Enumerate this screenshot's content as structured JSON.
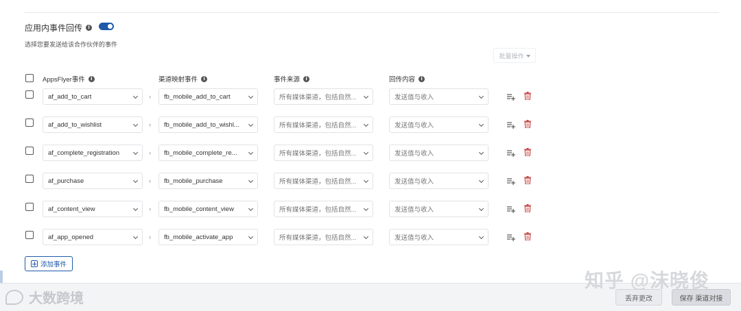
{
  "section": {
    "title": "应用内事件回传",
    "subtitle": "选择您要发送给该合作伙伴的事件",
    "toggle_on": true,
    "accent": "#1d59a8"
  },
  "bulk_action": {
    "label": "批量操作"
  },
  "columns": {
    "appsflyer": "AppsFlyer事件",
    "mapped": "渠道映射事件",
    "source": "事件来源",
    "content": "回传内容"
  },
  "rows": [
    {
      "af": "af_add_to_cart",
      "fb": "fb_mobile_add_to_cart",
      "source": "所有媒体渠道，包括自然...",
      "content": "发送值与收入"
    },
    {
      "af": "af_add_to_wishlist",
      "fb": "fb_mobile_add_to_wishl...",
      "source": "所有媒体渠道，包括自然...",
      "content": "发送值与收入"
    },
    {
      "af": "af_complete_registration",
      "fb": "fb_mobile_complete_re...",
      "source": "所有媒体渠道，包括自然...",
      "content": "发送值与收入"
    },
    {
      "af": "af_purchase",
      "fb": "fb_mobile_purchase",
      "source": "所有媒体渠道，包括自然...",
      "content": "发送值与收入"
    },
    {
      "af": "af_content_view",
      "fb": "fb_mobile_content_view",
      "source": "所有媒体渠道，包括自然...",
      "content": "发送值与收入"
    },
    {
      "af": "af_app_opened",
      "fb": "fb_mobile_activate_app",
      "source": "所有媒体渠道，包括自然...",
      "content": "发送值与收入"
    }
  ],
  "add_event": {
    "label": "添加事件"
  },
  "footer": {
    "discard_label": "丢弃更改",
    "save_label": "保存 渠道对接"
  },
  "watermarks": {
    "left": "大数跨境",
    "right": "知乎 @沫晓俊"
  }
}
